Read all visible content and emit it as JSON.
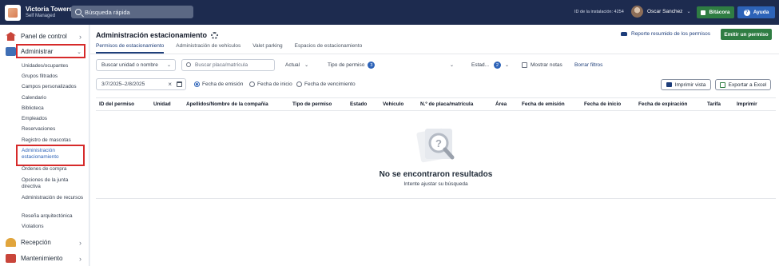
{
  "topbar": {
    "org_name": "Victoria Towers",
    "org_sub": "Self Managed",
    "search_label": "Búsqueda rápida",
    "installation_id": "ID de la instalación: 4254",
    "user_name": "Oscar Sanchez",
    "bitacora_label": "Bitácora",
    "ayuda_label": "Ayuda",
    "colors": {
      "bar": "#1d2b4f",
      "green": "#2f7d43",
      "blue": "#2d63b8"
    }
  },
  "sidebar": {
    "panel_label": "Panel de control",
    "administrar_label": "Administrar",
    "items": [
      "Unidades/ocupantes",
      "Grupos filtrados",
      "Campos personalizados",
      "Calendario",
      "Biblioteca",
      "Empleados",
      "Reservaciones",
      "Registro de mascotas",
      "Administración estacionamiento",
      "Órdenes de compra",
      "Opciones de la junta directiva",
      "Administración de recursos",
      "Reseña arquitectónica",
      "Violations"
    ],
    "recepcion_label": "Recepción",
    "mantenimiento_label": "Mantenimiento",
    "highlight_color": "#d62a2a"
  },
  "main": {
    "title": "Administración estacionamiento",
    "report_link": "Reporte resumido de los permisos",
    "emit_button": "Emitir un permiso",
    "tabs": [
      "Permisos de estacionamiento",
      "Administración de vehículos",
      "Valet parking",
      "Espacios de estacionamiento"
    ],
    "filters": {
      "unit_dropdown": "Buscar unidad o nombre",
      "plate_placeholder": "Buscar placa/matrícula",
      "status_filter": "Actual",
      "permit_type_label": "Tipo de permiso",
      "permit_type_count": "3",
      "estado_label": "Estad...",
      "estado_count": "2",
      "show_notes_label": "Mostrar notas",
      "clear_filters": "Borrar filtros",
      "date_range": "3/7/2025–2/8/2025",
      "radio_issue": "Fecha de emisión",
      "radio_start": "Fecha de inicio",
      "radio_expiry": "Fecha de vencimiento",
      "print_view": "Imprimir vista",
      "export_excel": "Exportar a Excel"
    },
    "table_headers": [
      "ID del permiso",
      "Unidad",
      "Apellidos/Nombre de la compañía",
      "Tipo de permiso",
      "Estado",
      "Vehículo",
      "N.º de placa/matrícula",
      "Área",
      "Fecha de emisión",
      "Fecha de inicio",
      "Fecha de expiración",
      "Tarifa",
      "Imprimir"
    ],
    "empty_title": "No se encontraron resultados",
    "empty_subtitle": "Intente ajustar su búsqueda"
  }
}
